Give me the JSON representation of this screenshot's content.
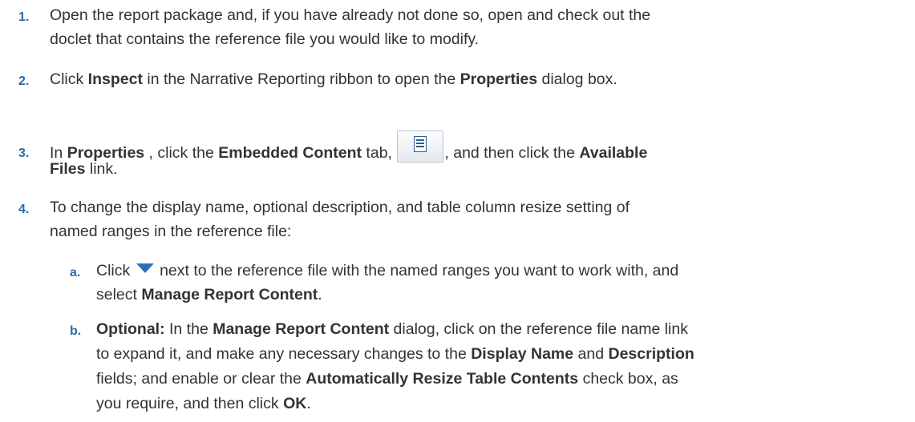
{
  "steps": [
    {
      "number": "1.",
      "line1": "Open the report package and, if you have already not done so, open and check out the",
      "line2": "doclet that contains the reference file you would like to modify."
    },
    {
      "number": "2.",
      "t1": "Click ",
      "b1": "Inspect",
      "t2": " in the Narrative Reporting ribbon to open the ",
      "b2": "Properties",
      "t3": " dialog box."
    },
    {
      "number": "3.",
      "t1": "In ",
      "b1": "Properties",
      "t2": " , click the ",
      "b2": "Embedded Content",
      "t3": " tab, ",
      "t4": ", and then click the ",
      "b3": "Available",
      "b4": "Files",
      "t5": " link.",
      "icon": "embedded-content-tab-icon"
    },
    {
      "number": "4.",
      "line1": "To change the display name, optional description, and table column resize setting of",
      "line2": "named ranges in the reference file:"
    }
  ],
  "substeps": [
    {
      "letter": "a.",
      "t1": "Click ",
      "icon": "dropdown-triangle-icon",
      "t2": " next to the reference file with the named ranges you want to work with, and",
      "t3": "select ",
      "b1": "Manage Report Content",
      "t4": "."
    },
    {
      "letter": "b.",
      "b1": "Optional:",
      "t1": " In the ",
      "b2": "Manage Report Content",
      "t2": " dialog, click on the reference file name link",
      "t3": "to expand it, and make any necessary changes to the ",
      "b3": "Display Name",
      "t4": " and ",
      "b4": "Description",
      "t5": "fields; and enable or clear the ",
      "b5": "Automatically Resize Table Contents",
      "t6": " check box, as",
      "t7": "you require, and then click ",
      "b6": "OK",
      "t8": "."
    }
  ],
  "colors": {
    "number": "#2b6aa8",
    "text": "#333333",
    "triangle": "#2d6fb5"
  }
}
